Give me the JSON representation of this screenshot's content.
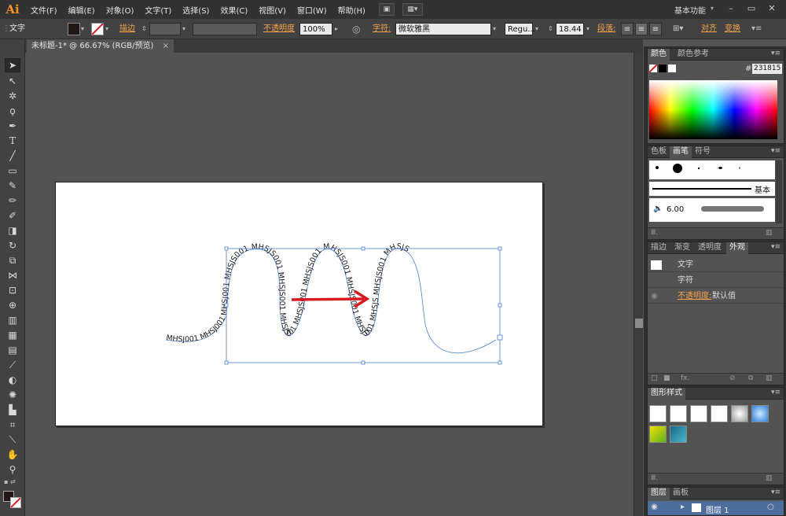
{
  "app": {
    "logo": "Ai"
  },
  "menu": [
    "文件(F)",
    "编辑(E)",
    "对象(O)",
    "文字(T)",
    "选择(S)",
    "效果(C)",
    "视图(V)",
    "窗口(W)",
    "帮助(H)"
  ],
  "workspace": "基本功能",
  "window_controls": {
    "minimize": "–",
    "restore": "▭",
    "close": "✕"
  },
  "control_bar": {
    "mode": "文字",
    "stroke_label": "描边",
    "opacity_label": "不透明度",
    "opacity_value": "100%",
    "char_label": "字符:",
    "font_family": "微软雅黑",
    "font_style": "Regu...",
    "font_size": "18.44",
    "para_label": "段落:",
    "align_label": "对齐",
    "transform_label": "变换"
  },
  "document": {
    "tab_title": "未标题-1* @ 66.67% (RGB/预览)",
    "close": "×"
  },
  "canvas": {
    "path_text": "MHSJ001 MHSJ001 MHSJ001 MHSJS001 MHSJS001 MHSJS001 MHSJS001 MHSJS001 MHSJS001 MHSJS001 MHSJS001 MHSJS001 MHSJS MHSJS001 MHSJS"
  },
  "panels": {
    "color": {
      "tabs": [
        "颜色",
        "颜色参考"
      ],
      "hex_label": "#",
      "hex_value": "231815"
    },
    "brushes": {
      "tabs": [
        "色板",
        "画笔",
        "符号"
      ],
      "basic_label": "基本",
      "brush_size": "6.00"
    },
    "appearance": {
      "tabs": [
        "描边",
        "渐变",
        "透明度",
        "外观"
      ],
      "object_label": "文字",
      "char_label": "字符",
      "opacity_label": "不透明度:",
      "opacity_value": "默认值",
      "fx_label": "fx."
    },
    "graphic_styles": {
      "tabs": [
        "图形样式"
      ]
    },
    "layers": {
      "tabs": [
        "图层",
        "画板"
      ],
      "layer_name": "图层 1"
    }
  },
  "colors": {
    "accent": "#f6a24a",
    "selection": "#4a7fd6",
    "arrow": "#d71920",
    "fill_swatch": "#231815"
  }
}
